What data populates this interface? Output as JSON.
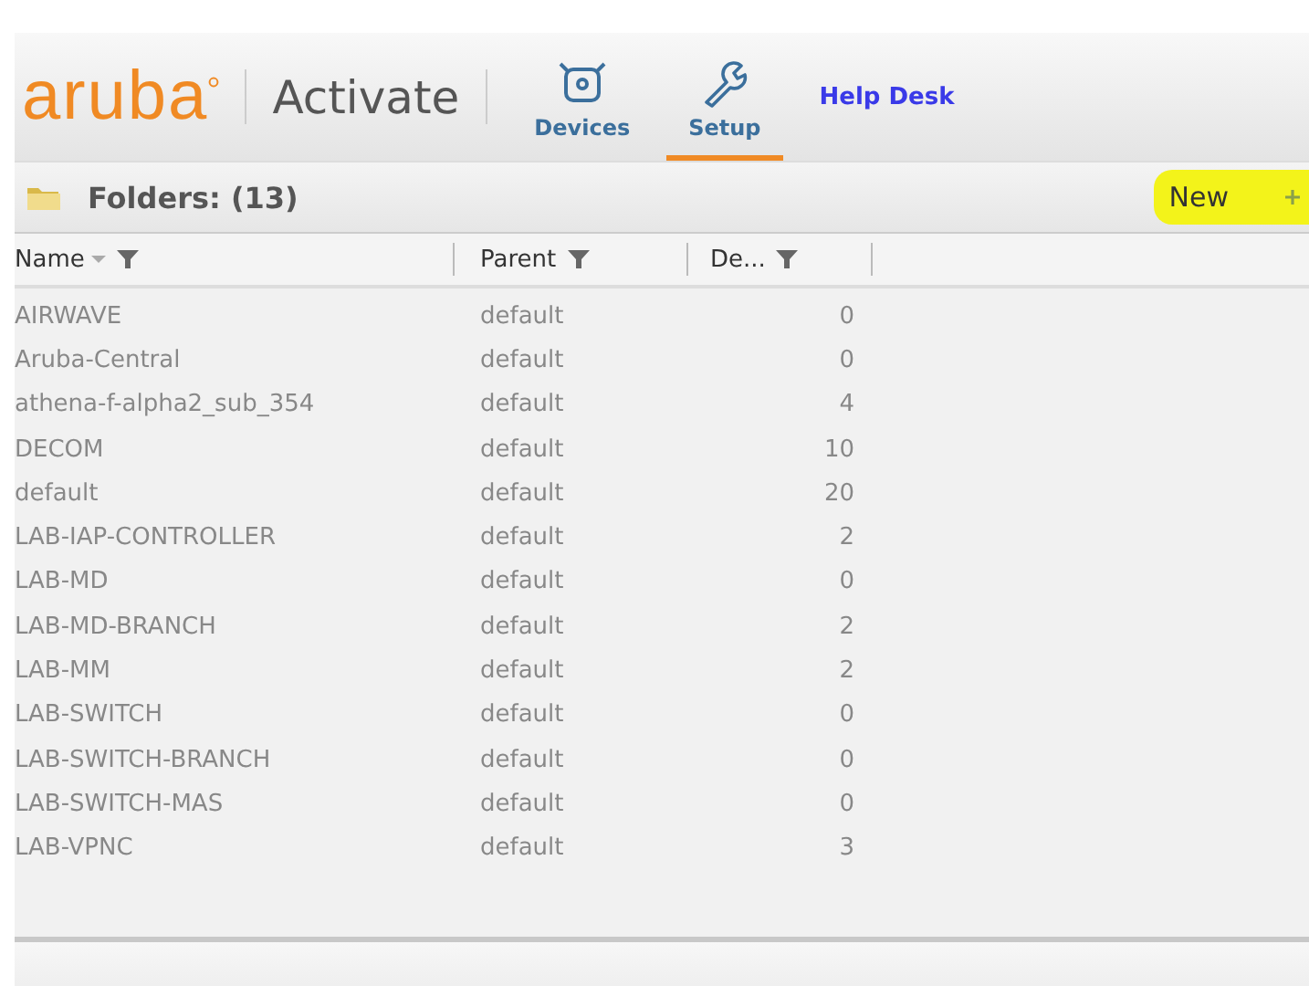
{
  "header": {
    "logo": "aruba",
    "app_title": "Activate",
    "tabs": [
      {
        "label": "Devices",
        "kind": "device",
        "selected": false
      },
      {
        "label": "Setup",
        "kind": "tool",
        "selected": true
      }
    ],
    "help_link": "Help Desk"
  },
  "toolbar": {
    "title": "Folders: (13)",
    "new_button": "New"
  },
  "table": {
    "columns": [
      {
        "label": "Name",
        "sorted": true
      },
      {
        "label": "Parent",
        "sorted": false
      },
      {
        "label": "De...",
        "sorted": false
      }
    ],
    "rows": [
      [
        "AIRWAVE",
        "default",
        "0"
      ],
      [
        "Aruba-Central",
        "default",
        "0"
      ],
      [
        "athena-f-alpha2_sub_354",
        "default",
        "4"
      ],
      [
        "DECOM",
        "default",
        "10"
      ],
      [
        "default",
        "default",
        "20"
      ],
      [
        "LAB-IAP-CONTROLLER",
        "default",
        "2"
      ],
      [
        "LAB-MD",
        "default",
        "0"
      ],
      [
        "LAB-MD-BRANCH",
        "default",
        "2"
      ],
      [
        "LAB-MM",
        "default",
        "2"
      ],
      [
        "LAB-SWITCH",
        "default",
        "0"
      ],
      [
        "LAB-SWITCH-BRANCH",
        "default",
        "0"
      ],
      [
        "LAB-SWITCH-MAS",
        "default",
        "0"
      ],
      [
        "LAB-VPNC",
        "default",
        "3"
      ]
    ]
  }
}
